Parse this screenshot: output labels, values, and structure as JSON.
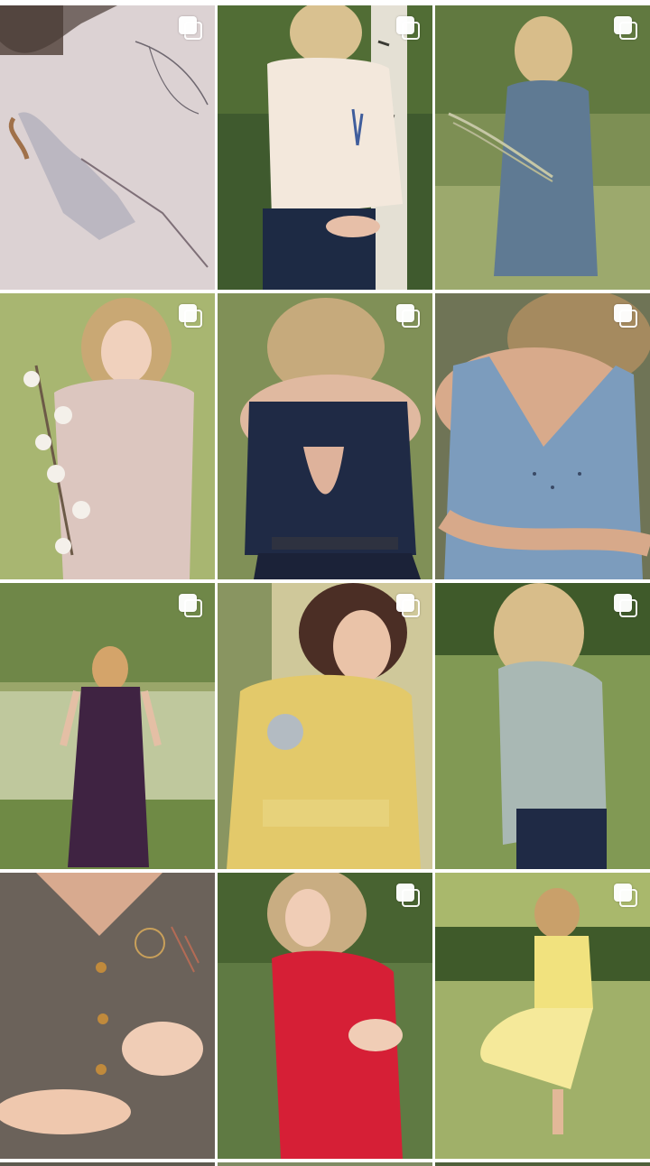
{
  "screen": {
    "background": "#ffffff"
  },
  "grid": {
    "columns": 3,
    "tiles": [
      {
        "id": "t1",
        "subject": "fashion-sketch",
        "bg": "#d9cfcf",
        "accent": "#7b7483",
        "multi": true
      },
      {
        "id": "t2",
        "subject": "cream-blouse",
        "bg": "#3f5a2e",
        "accent": "#f3e8dc",
        "multi": true
      },
      {
        "id": "t3",
        "subject": "blue-wrap-dress",
        "bg": "#7d8f54",
        "accent": "#5f7a93",
        "multi": true
      },
      {
        "id": "t4",
        "subject": "pink-top-cotton",
        "bg": "#9fae6a",
        "accent": "#dcc6bf",
        "multi": true
      },
      {
        "id": "t5",
        "subject": "navy-open-back-top",
        "bg": "#6f7f4a",
        "accent": "#222c46",
        "multi": true
      },
      {
        "id": "t6",
        "subject": "blue-strap-dress",
        "bg": "#6f7456",
        "accent": "#7c9cbd",
        "multi": true
      },
      {
        "id": "t7",
        "subject": "plum-dress-garden",
        "bg": "#9aa66a",
        "accent": "#3f2342",
        "multi": true
      },
      {
        "id": "t8",
        "subject": "yellow-dress-portrait",
        "bg": "#cfc89a",
        "accent": "#e3c96a",
        "multi": true
      },
      {
        "id": "t9",
        "subject": "grey-blouse-field",
        "bg": "#6f8a48",
        "accent": "#a9b8b4",
        "multi": true
      },
      {
        "id": "t10",
        "subject": "grey-embroidered-dress",
        "bg": "#5e5750",
        "accent": "#6b625a",
        "multi": false
      },
      {
        "id": "t11",
        "subject": "red-dress",
        "bg": "#5f7a43",
        "accent": "#d61f36",
        "multi": true
      },
      {
        "id": "t12",
        "subject": "yellow-dress-twirl",
        "bg": "#6d8640",
        "accent": "#f1e27e",
        "multi": true
      }
    ]
  }
}
